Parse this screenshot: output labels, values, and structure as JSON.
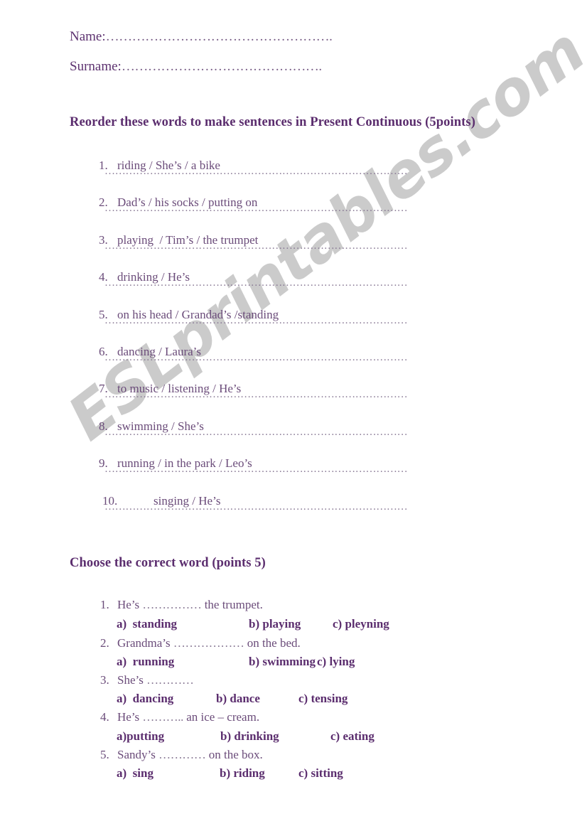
{
  "document": {
    "type": "esl-worksheet",
    "background_color": "#ffffff",
    "heading_color": "#5b2d6e",
    "body_color": "#6b4c7a",
    "dots_color": "#887894"
  },
  "watermark": {
    "text": "ESLprintables.com",
    "color": "#c9c9c9",
    "rotation_deg": -37.5
  },
  "fields": {
    "name": {
      "label": "Name:",
      "dots": "……………………………………………."
    },
    "surname": {
      "label": "Surname:",
      "dots": "………………………………………."
    }
  },
  "section1": {
    "heading": "Reorder these words to make sentences in Present Continuous (5points)",
    "answer_dots": "……………………………………………………………………………",
    "items": [
      {
        "number": "1.",
        "text": "riding / She’s / a bike"
      },
      {
        "number": "2.",
        "text": "Dad’s / his socks / putting on"
      },
      {
        "number": "3.",
        "text": "playing  / Tim’s / the trumpet"
      },
      {
        "number": "4.",
        "text": "drinking / He’s"
      },
      {
        "number": "5.",
        "text": "on his head / Grandad’s /standing"
      },
      {
        "number": "6.",
        "text": "dancing / Laura’s"
      },
      {
        "number": "7.",
        "text": "to music / listening / He’s"
      },
      {
        "number": "8.",
        "text": "swimming / She’s"
      },
      {
        "number": "9.",
        "text": "running / in the park / Leo’s"
      },
      {
        "number": "10.",
        "text": "singing / He’s"
      }
    ]
  },
  "section2": {
    "heading": "Choose the correct word (points 5)",
    "questions": [
      {
        "number": "1.",
        "prompt_before": "He’s ",
        "blank": "……………",
        "prompt_after": " the trumpet.",
        "options": [
          {
            "label": "a)  standing"
          },
          {
            "label": "b) playing"
          },
          {
            "label": "c) pleyning"
          }
        ]
      },
      {
        "number": "2.",
        "prompt_before": "Grandma’s ",
        "blank": "………………",
        "prompt_after": " on the bed.",
        "options": [
          {
            "label": "a)  running"
          },
          {
            "label": "b) swimming"
          },
          {
            "label": "c) lying"
          }
        ]
      },
      {
        "number": "3.",
        "prompt_before": "She’s ",
        "blank": "…………",
        "prompt_after": "",
        "options": [
          {
            "label": "a)  dancing"
          },
          {
            "label": "b) dance"
          },
          {
            "label": "c) tensing"
          }
        ]
      },
      {
        "number": "4.",
        "prompt_before": "He’s ",
        "blank": "………..",
        "prompt_after": " an ice – cream.",
        "options": [
          {
            "label": "a)putting"
          },
          {
            "label": "b) drinking"
          },
          {
            "label": "c) eating"
          }
        ]
      },
      {
        "number": "5.",
        "prompt_before": "Sandy’s ",
        "blank": "…………",
        "prompt_after": " on the box.",
        "options": [
          {
            "label": "a)  sing"
          },
          {
            "label": "b) riding"
          },
          {
            "label": "c) sitting"
          }
        ]
      }
    ]
  }
}
